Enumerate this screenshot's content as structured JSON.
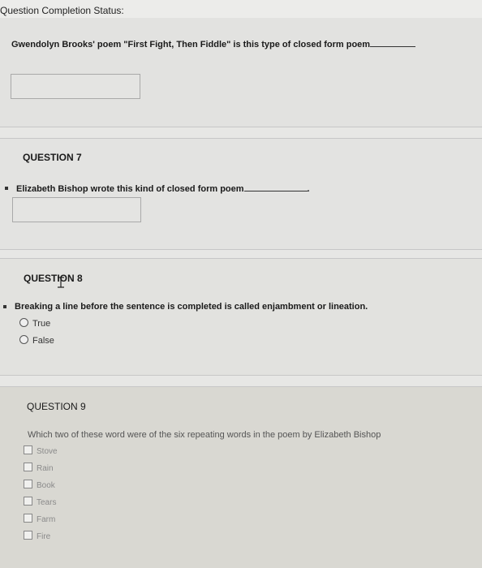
{
  "header": {
    "status_label": "Question Completion Status:"
  },
  "q6": {
    "prompt": "Gwendolyn Brooks' poem \"First Fight, Then Fiddle\" is this type of closed form poem",
    "answer_value": ""
  },
  "q7": {
    "title": "QUESTION 7",
    "prompt": "Elizabeth Bishop wrote this kind of closed form poem",
    "answer_value": ""
  },
  "q8": {
    "title": "QUESTION 8",
    "prompt": "Breaking a line before the sentence is completed is called enjambment or lineation.",
    "options": [
      "True",
      "False"
    ]
  },
  "q9": {
    "title": "QUESTION 9",
    "prompt": "Which two of these word were of the six repeating words in the poem by Elizabeth Bishop",
    "options": [
      "Stove",
      "Rain",
      "Book",
      "Tears",
      "Farm",
      "Fire"
    ]
  }
}
